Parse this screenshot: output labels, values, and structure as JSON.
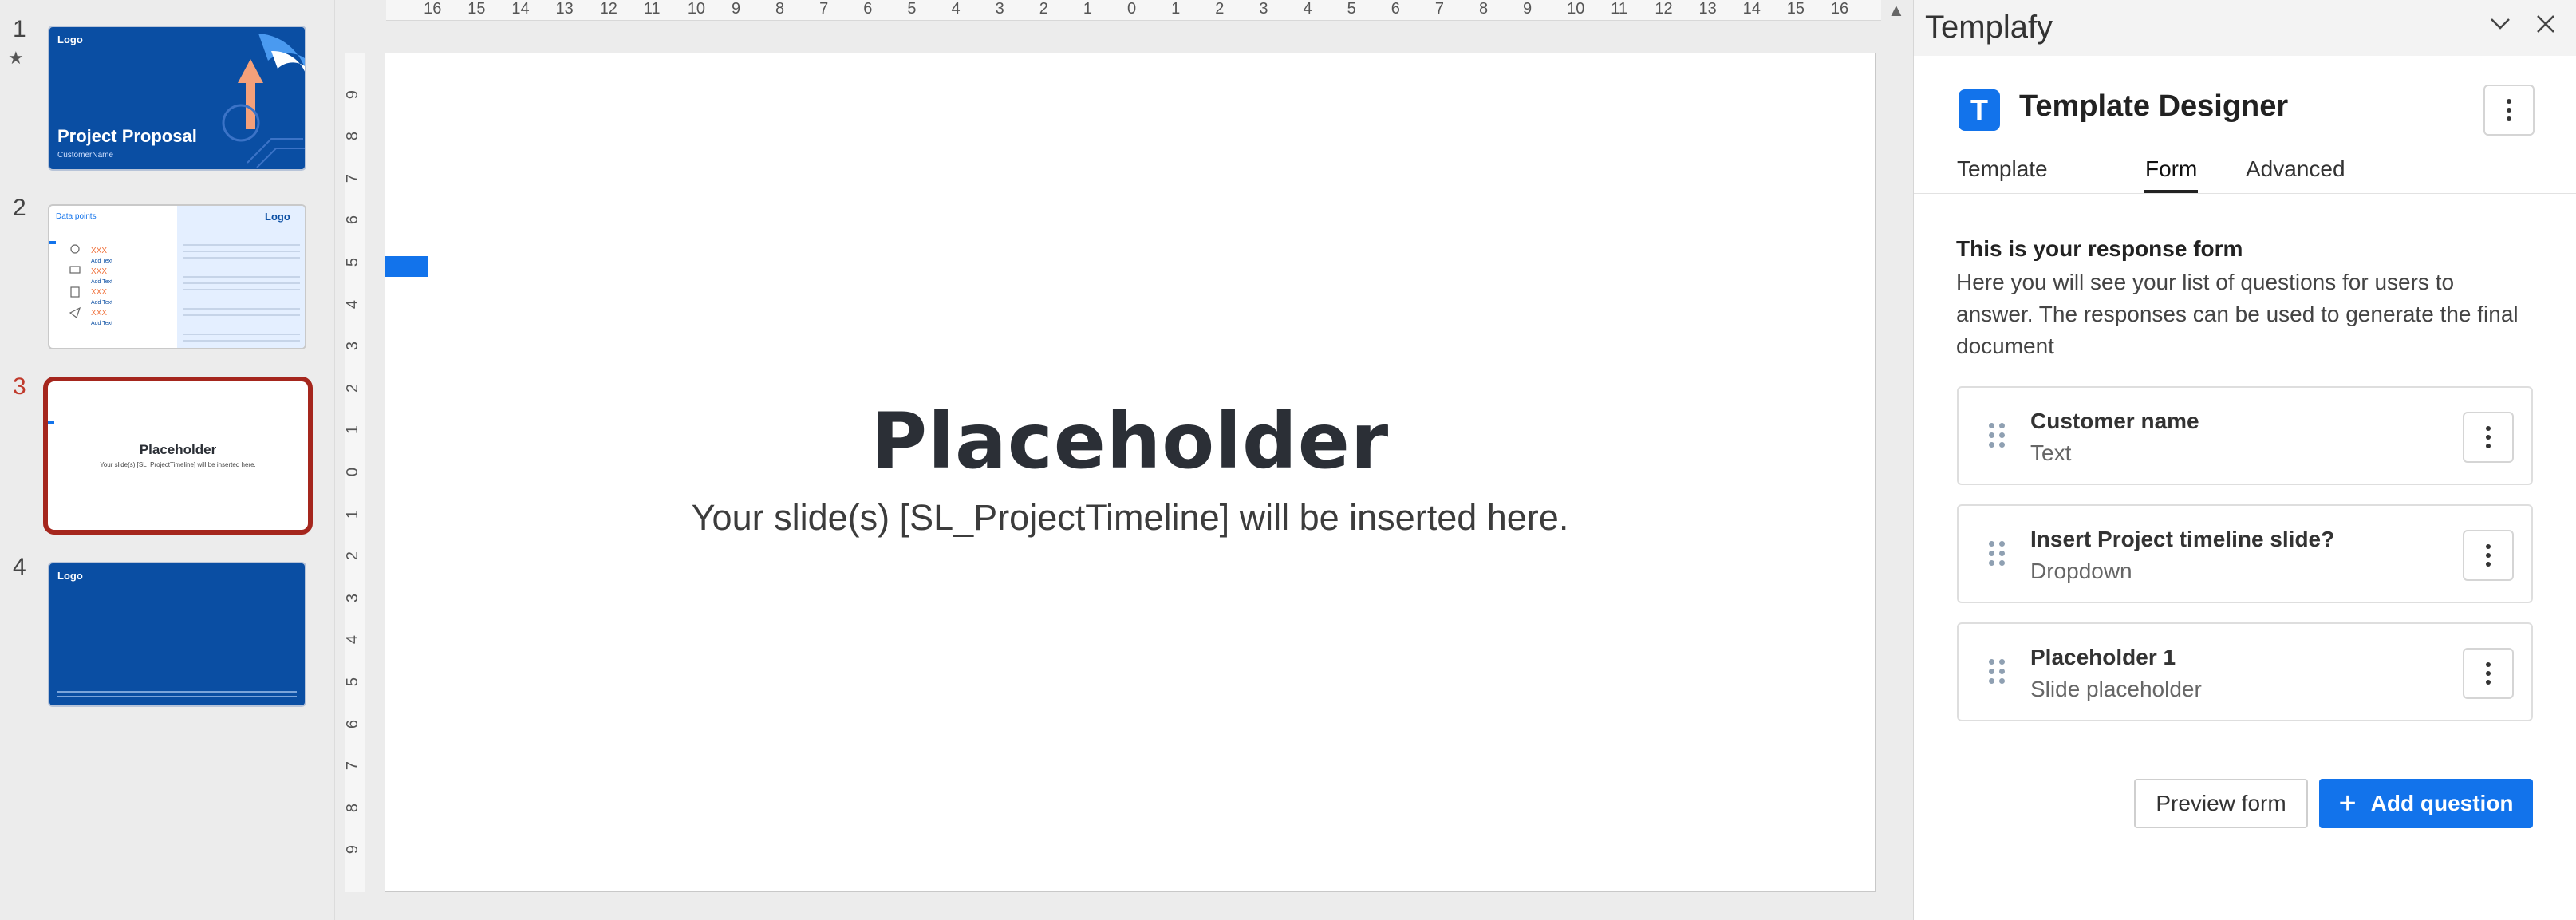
{
  "thumbnails": [
    {
      "number": "1",
      "star": "★",
      "logo": "Logo",
      "title": "Project Proposal",
      "subtitle": "CustomerName"
    },
    {
      "number": "2",
      "logo": "Logo",
      "heading": "Data points",
      "items": [
        {
          "value": "XXX",
          "label": "Add Text"
        },
        {
          "value": "XXX",
          "label": "Add Text"
        },
        {
          "value": "XXX",
          "label": "Add Text"
        },
        {
          "value": "XXX",
          "label": "Add Text"
        }
      ]
    },
    {
      "number": "3",
      "title": "Placeholder",
      "subtitle": "Your slide(s) [SL_ProjectTimeline] will be inserted here."
    },
    {
      "number": "4",
      "logo": "Logo"
    }
  ],
  "ruler": {
    "horizontal": [
      "16",
      "15",
      "14",
      "13",
      "12",
      "11",
      "10",
      "9",
      "8",
      "7",
      "6",
      "5",
      "4",
      "3",
      "2",
      "1",
      "0",
      "1",
      "2",
      "3",
      "4",
      "5",
      "6",
      "7",
      "8",
      "9",
      "10",
      "11",
      "12",
      "13",
      "14",
      "15",
      "16"
    ],
    "vertical": [
      "9",
      "8",
      "7",
      "6",
      "5",
      "4",
      "3",
      "2",
      "1",
      "0",
      "1",
      "2",
      "3",
      "4",
      "5",
      "6",
      "7",
      "8",
      "9"
    ]
  },
  "slide": {
    "title": "Placeholder",
    "subtitle": "Your slide(s) [SL_ProjectTimeline] will be inserted here."
  },
  "panel": {
    "title": "Templafy",
    "designer_title": "Template Designer",
    "logo_letter": "T",
    "tabs": [
      {
        "label": "Template"
      },
      {
        "label": "Form"
      },
      {
        "label": "Advanced"
      }
    ],
    "active_tab": "Form",
    "form_heading": "This is your response form",
    "form_description": "Here you will see your list of questions for users to answer. The responses can be used to generate the final document",
    "questions": [
      {
        "title": "Customer name",
        "type": "Text"
      },
      {
        "title": "Insert Project timeline slide?",
        "type": "Dropdown"
      },
      {
        "title": "Placeholder 1",
        "type": "Slide placeholder"
      }
    ],
    "preview_label": "Preview form",
    "add_label": "Add question",
    "add_icon": "+"
  },
  "colors": {
    "accent": "#1273eb",
    "selected_border": "#a5261d",
    "brand_blue": "#0a4ea3"
  }
}
